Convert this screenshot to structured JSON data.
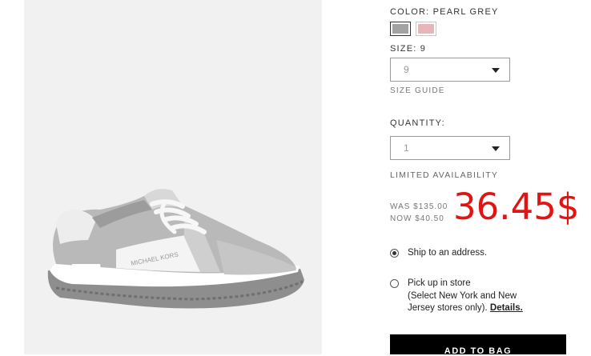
{
  "product": {
    "image_alt": "grey sneaker",
    "brand_print": "MICHAEL KORS"
  },
  "color": {
    "label": "COLOR: PEARL GREY",
    "swatches": [
      {
        "name": "pearl grey",
        "hex": "#a3a3a3",
        "selected": true
      },
      {
        "name": "pink",
        "hex": "#e8b6ba",
        "selected": false
      }
    ]
  },
  "size": {
    "label": "SIZE: 9",
    "value": "9",
    "guide_link": "SIZE GUIDE"
  },
  "quantity": {
    "label": "QUANTITY:",
    "value": "1"
  },
  "availability": "LIMITED AVAILABILITY",
  "price": {
    "was": "WAS $135.00",
    "now": "NOW $40.50",
    "overlay": "36.45$",
    "overlay_color": "#e11414"
  },
  "fulfillment": {
    "ship_label": "Ship to an address.",
    "pickup_label": "Pick up in store",
    "pickup_note": "(Select New York and New",
    "pickup_note2": "Jersey stores only).",
    "details_link": "Details."
  },
  "add_to_bag": "ADD TO BAG"
}
